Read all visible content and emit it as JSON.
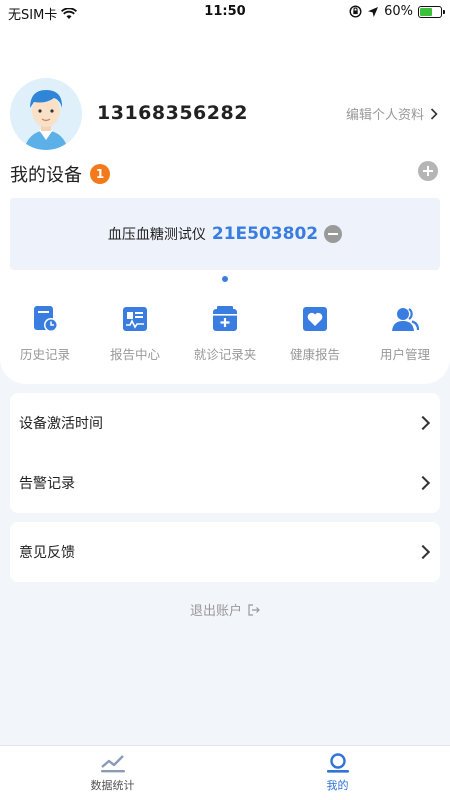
{
  "status_bar": {
    "carrier": "无SIM卡",
    "time": "11:50",
    "battery_percent": "60%",
    "battery_level": 0.6
  },
  "profile": {
    "phone": "13168356282",
    "edit_label": "编辑个人资料"
  },
  "devices": {
    "title": "我的设备",
    "badge_count": "1",
    "items": [
      {
        "name": "血压血糖测试仪",
        "code": "21E503802"
      }
    ]
  },
  "menu": [
    {
      "label": "历史记录",
      "icon": "history-icon"
    },
    {
      "label": "报告中心",
      "icon": "report-center-icon"
    },
    {
      "label": "就诊记录夹",
      "icon": "visit-folder-icon"
    },
    {
      "label": "健康报告",
      "icon": "health-report-icon"
    },
    {
      "label": "用户管理",
      "icon": "user-management-icon"
    }
  ],
  "settings_list": [
    {
      "label": "设备激活时间"
    },
    {
      "label": "告警记录"
    }
  ],
  "feedback_list": [
    {
      "label": "意见反馈"
    }
  ],
  "logout_label": "退出账户",
  "tabs": [
    {
      "label": "数据统计",
      "icon": "chart-trend-icon",
      "active": false
    },
    {
      "label": "我的",
      "icon": "profile-icon",
      "active": true
    }
  ],
  "colors": {
    "accent": "#3a7de0",
    "badge": "#f27a1a",
    "background": "#f2f5fa"
  }
}
